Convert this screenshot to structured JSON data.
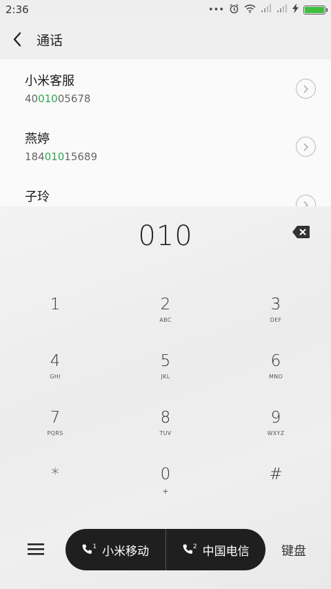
{
  "status_bar": {
    "time": "2:36",
    "icons": [
      "more-dots-icon",
      "alarm-icon",
      "wifi-icon",
      "signal-icon",
      "signal-icon",
      "charging-icon",
      "battery-icon"
    ],
    "battery_color": "#3ec03e"
  },
  "header": {
    "title": "通话"
  },
  "contacts": [
    {
      "name": "小米客服",
      "number_pre": "40",
      "number_match": "010",
      "number_post": "05678"
    },
    {
      "name": "燕婷",
      "number_pre": "184",
      "number_match": "010",
      "number_post": "15689"
    },
    {
      "name": "子玲",
      "number_pre": "",
      "number_match": "",
      "number_post": ""
    }
  ],
  "highlight_color": "#2fa84f",
  "dialpad": {
    "input": "010",
    "keys": [
      {
        "digit": "1",
        "letters": ""
      },
      {
        "digit": "2",
        "letters": "ABC"
      },
      {
        "digit": "3",
        "letters": "DEF"
      },
      {
        "digit": "4",
        "letters": "GHI"
      },
      {
        "digit": "5",
        "letters": "JKL"
      },
      {
        "digit": "6",
        "letters": "MNO"
      },
      {
        "digit": "7",
        "letters": "PQRS"
      },
      {
        "digit": "8",
        "letters": "TUV"
      },
      {
        "digit": "9",
        "letters": "WXYZ"
      },
      {
        "digit": "*",
        "letters": ""
      },
      {
        "digit": "0",
        "letters": "+"
      },
      {
        "digit": "#",
        "letters": ""
      }
    ]
  },
  "bottom_bar": {
    "sim1_label": "小米移动",
    "sim1_index": "1",
    "sim2_label": "中国电信",
    "sim2_index": "2",
    "keyboard_label": "键盘"
  }
}
